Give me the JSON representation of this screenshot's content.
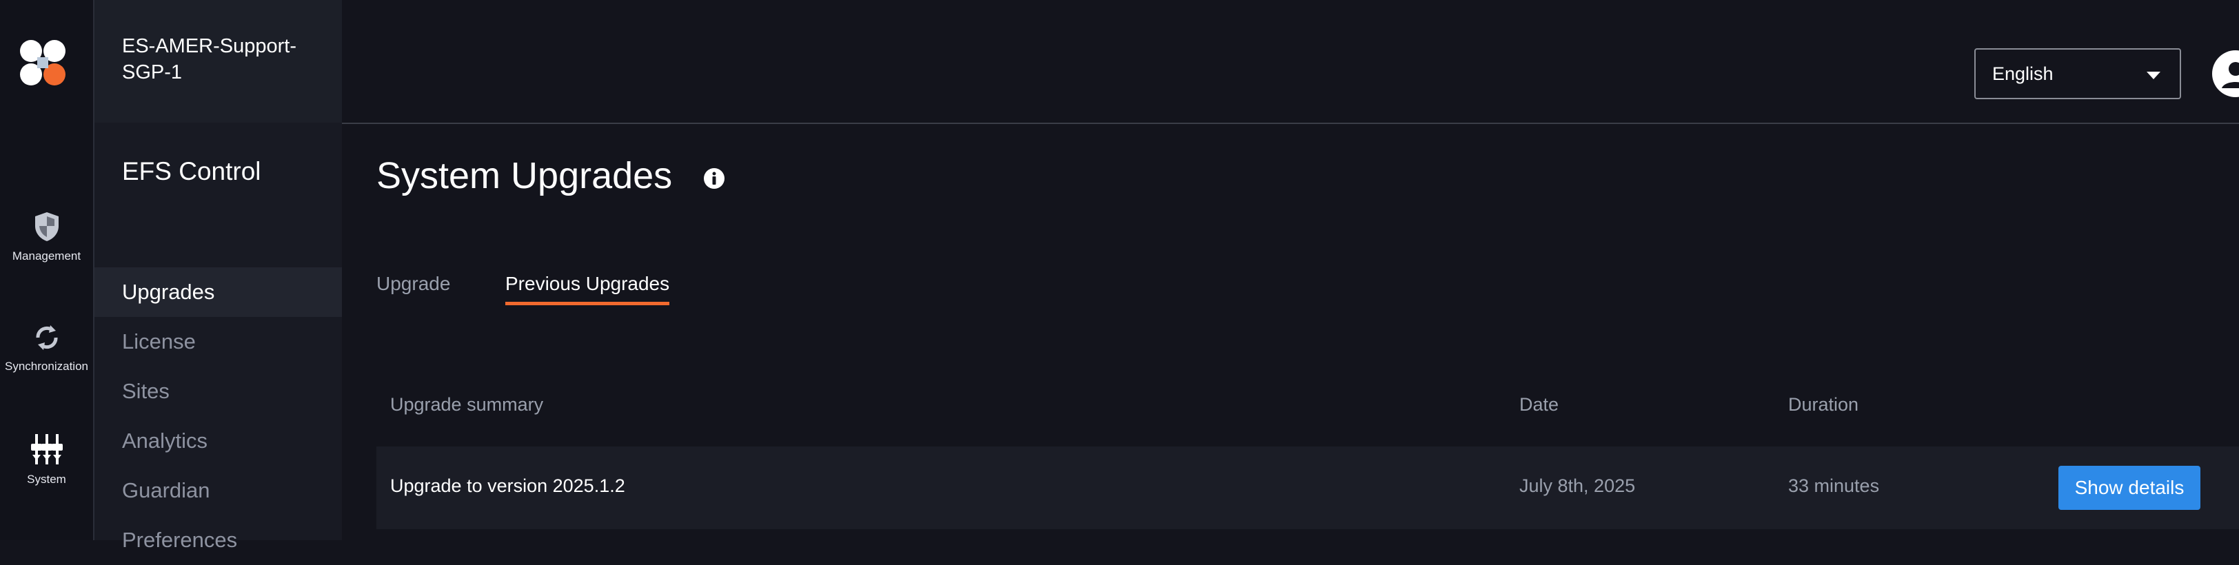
{
  "rail": {
    "items": [
      {
        "label": "Management",
        "icon": "shield-icon"
      },
      {
        "label": "Synchronization",
        "icon": "sync-icon"
      },
      {
        "label": "System",
        "icon": "sliders-icon"
      }
    ]
  },
  "org": {
    "name": "ES-AMER-Support-SGP-1"
  },
  "app": {
    "title": "EFS Control"
  },
  "nav": {
    "items": [
      {
        "label": "Upgrades",
        "active": true
      },
      {
        "label": "License"
      },
      {
        "label": "Sites"
      },
      {
        "label": "Analytics"
      },
      {
        "label": "Guardian"
      },
      {
        "label": "Preferences"
      }
    ]
  },
  "header": {
    "language": "English"
  },
  "page": {
    "title": "System Upgrades"
  },
  "tabs": [
    {
      "label": "Upgrade",
      "active": false
    },
    {
      "label": "Previous Upgrades",
      "active": true
    }
  ],
  "table": {
    "columns": [
      "Upgrade summary",
      "Date",
      "Duration"
    ],
    "rows": [
      {
        "summary": "Upgrade to version 2025.1.2",
        "date": "July 8th, 2025",
        "duration": "33 minutes",
        "action": "Show details"
      }
    ]
  },
  "colors": {
    "accent": "#f26a2e",
    "primary_button": "#2d8ae8",
    "background": "#13141c"
  }
}
